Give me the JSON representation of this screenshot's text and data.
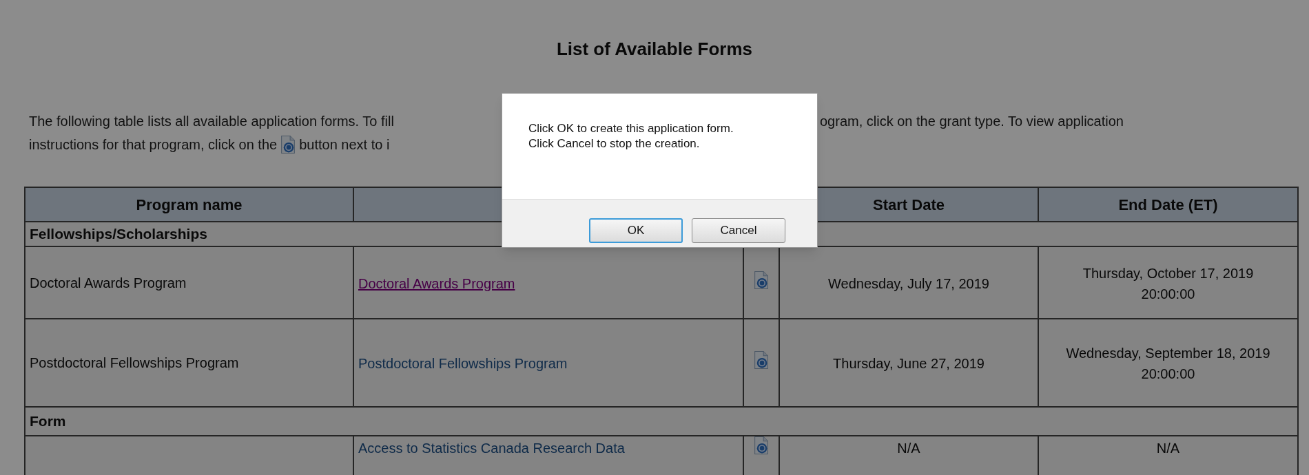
{
  "page": {
    "title": "List of Available Forms",
    "intro": [
      {
        "parts": [
          {
            "kind": "text",
            "text": "The following table lists all available application forms. To fill"
          },
          {
            "kind": "gap"
          },
          {
            "kind": "text",
            "text": "ogram, click on the grant type. To view application"
          }
        ]
      },
      {
        "parts": [
          {
            "kind": "text",
            "text": "instructions for that program, click on the"
          },
          {
            "kind": "icon"
          },
          {
            "kind": "text",
            "text": "button next to i"
          }
        ]
      }
    ]
  },
  "table": {
    "columns": [
      "Program name",
      "",
      "",
      "Start Date",
      "End Date (ET)"
    ],
    "sections": [
      {
        "title": "Fellowships/Scholarships",
        "rows": [
          {
            "program_name": "Doctoral Awards Program",
            "link": {
              "text": "Doctoral Awards Program",
              "visited": true
            },
            "start_date": "Wednesday, July 17, 2019",
            "end_date": [
              "Thursday, October 17, 2019",
              "20:00:00"
            ]
          },
          {
            "program_name": "Postdoctoral Fellowships Program",
            "link": {
              "text": "Postdoctoral Fellowships Program",
              "visited": false
            },
            "start_date": "Thursday, June 27, 2019",
            "end_date": [
              "Wednesday, September 18, 2019",
              "20:00:00"
            ]
          }
        ]
      },
      {
        "title": "Form",
        "rows": [
          {
            "program_name": "",
            "link": {
              "text": "Access to Statistics Canada Research Data",
              "visited": false
            },
            "start_date": "N/A",
            "end_date": [
              "N/A"
            ]
          }
        ]
      }
    ]
  },
  "dialog": {
    "lines": [
      "Click OK to create this application form.",
      "Click Cancel to stop the creation."
    ],
    "buttons": [
      {
        "label": "OK",
        "focused": true
      },
      {
        "label": "Cancel",
        "focused": false
      }
    ]
  }
}
